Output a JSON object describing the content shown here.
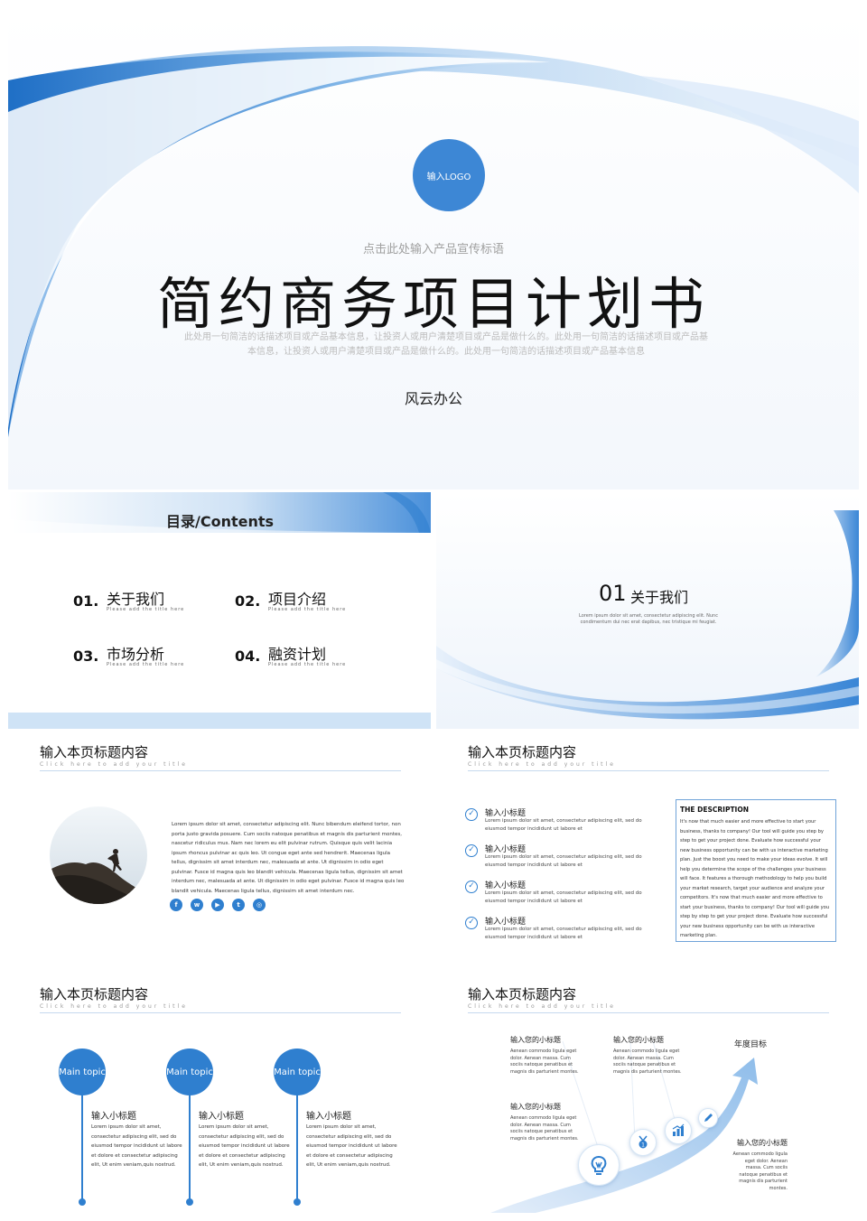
{
  "cover": {
    "logo": "输入LOGO",
    "slogan": "点击此处输入产品宣传标语",
    "title": "简约商务项目计划书",
    "description": "此处用一句简洁的话描述项目或产品基本信息，让投资人或用户清楚项目或产品是做什么的。此处用一句简洁的话描述项目或产品基本信息，让投资人或用户清楚项目或产品是做什么的。此处用一句简洁的话描述项目或产品基本信息",
    "company": "风云办公"
  },
  "contents": {
    "title": "目录/Contents",
    "items": [
      {
        "num": "01.",
        "label": "关于我们",
        "sub": "Please add the title here"
      },
      {
        "num": "02.",
        "label": "项目介绍",
        "sub": "Please add the title here"
      },
      {
        "num": "03.",
        "label": "市场分析",
        "sub": "Please add the title here"
      },
      {
        "num": "04.",
        "label": "融资计划",
        "sub": "Please add the title here"
      }
    ]
  },
  "section": {
    "num": "01",
    "label": "关于我们",
    "desc": "Lorem ipsum dolor sit amet, consectetur adipiscing elit. Nunc condimentum dui nec erat dapibus, nec tristique mi feugiat."
  },
  "header": {
    "title": "输入本页标题内容",
    "subtitle": "Click here to add your title"
  },
  "slide_photo": {
    "paragraph": "Lorem ipsum dolor sit amet, consectetur adipiscing elit. Nunc bibendum eleifend tortor, non porta justo gravida posuere. Cum sociis natoque penatibus et magnis dis parturient montes, nascetur ridiculus mus. Nam nec lorem eu elit pulvinar rutrum. Quisque quis velit lacinia ipsum rhoncus pulvinar ac quis leo. Ut congue eget ante sed hendrerit. Maecenas ligula tellus, dignissim sit amet interdum nec, malesuada at ante. Ut dignissim in odio eget pulvinar. Fusce id magna quis leo blandit vehicula. Maecenas ligula tellus, dignissim sit amet interdum nec, malesuada at ante. Ut dignissim in odio eget pulvinar. Fusce id magna quis leo blandit vehicula. Maecenas ligula tellus, dignissim sit amet interdum nec.",
    "socials": [
      "f",
      "w",
      "▶",
      "t",
      "◎"
    ]
  },
  "slide_list": {
    "items": [
      {
        "title": "输入小标题",
        "text": "Lorem ipsum dolor sit amet, consectetur adipiscing elit, sed do eiusmod tempor incididunt ut labore et"
      },
      {
        "title": "输入小标题",
        "text": "Lorem ipsum dolor sit amet, consectetur adipiscing elit, sed do eiusmod tempor incididunt ut labore et"
      },
      {
        "title": "输入小标题",
        "text": "Lorem ipsum dolor sit amet, consectetur adipiscing elit, sed do eiusmod tempor incididunt ut labore et"
      },
      {
        "title": "输入小标题",
        "text": "Lorem ipsum dolor sit amet, consectetur adipiscing elit, sed do eiusmod tempor incididunt ut labore et"
      }
    ],
    "desc_title": "THE DESCRIPTION",
    "desc_text": "It's now that much easier and more effective to start your business, thanks to company! Our tool will guide you step by step to get your project done. Evaluate how successful your new business opportunity can be with us interactive marketing plan. Just the boost you need to make your ideas evolve. It will help you determine the scope of the challenges your business will face. It features a thorough methodology to help you build your market research, target your audience and analyze your competitors. It's now that much easier and more effective to start your business, thanks to company! Our tool will guide you step by step to get your project done. Evaluate how successful your new business opportunity can be with us interactive marketing plan."
  },
  "slide_topics": {
    "topics": [
      {
        "circle": "Main topic",
        "title": "输入小标题",
        "text": "Lorem ipsum dolor sit amet, consectetur adipiscing elit, sed do eiusmod tempor incididunt ut labore et dolore et consectetur adipiscing elit, Ut enim veniam,quis nostrud."
      },
      {
        "circle": "Main topic",
        "title": "输入小标题",
        "text": "Lorem ipsum dolor sit amet, consectetur adipiscing elit, sed do eiusmod tempor incididunt ut labore et dolore et consectetur adipiscing elit, Ut enim veniam,quis nostrud."
      },
      {
        "circle": "Main topic",
        "title": "输入小标题",
        "text": "Lorem ipsum dolor sit amet, consectetur adipiscing elit, sed do eiusmod tempor incididunt ut labore et dolore et consectetur adipiscing elit, Ut enim veniam,quis nostrud."
      }
    ]
  },
  "slide_growth": {
    "goal": "年度目标",
    "blocks": [
      {
        "title": "输入您的小标题",
        "text": "Aenean commodo ligula eget dolor. Aenean massa. Cum sociis natoque penatibus et magnis dis parturient montes."
      },
      {
        "title": "输入您的小标题",
        "text": "Aenean commodo ligula eget dolor. Aenean massa. Cum sociis natoque penatibus et magnis dis parturient montes."
      },
      {
        "title": "输入您的小标题",
        "text": "Aenean commodo ligula eget dolor. Aenean massa. Cum sociis natoque penatibus et magnis dis parturient montes."
      },
      {
        "title": "输入您的小标题",
        "text": "Aenean commodo ligula eget dolor. Aenean massa. Cum sociis natoque penatibus et magnis dis parturient montes."
      }
    ],
    "icons": [
      "lightbulb-icon",
      "medal-icon",
      "bar-chart-icon",
      "pencil-icon"
    ]
  },
  "colors": {
    "accent": "#2f7fcf",
    "light": "#cfe3f6"
  }
}
